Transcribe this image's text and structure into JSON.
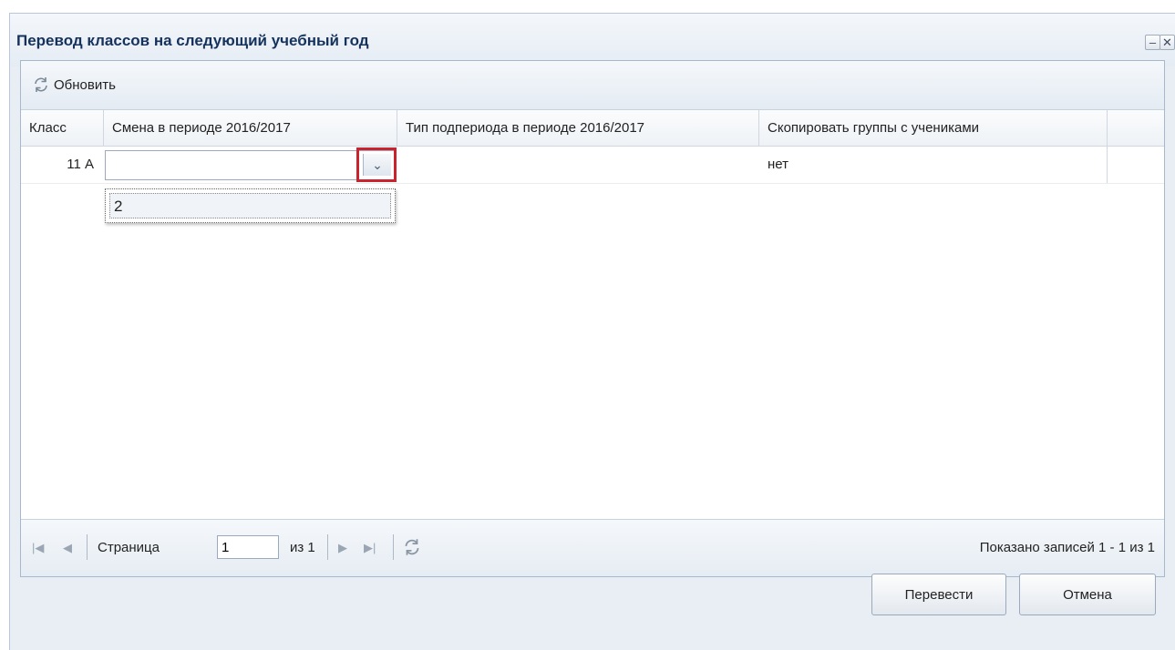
{
  "window": {
    "title": "Перевод классов на следующий учебный год"
  },
  "toolbar": {
    "refresh_label": "Обновить"
  },
  "grid": {
    "columns": [
      "Класс",
      "Смена в периоде 2016/2017",
      "Тип подпериода в периоде 2016/2017",
      "Скопировать группы с учениками"
    ],
    "rows": [
      {
        "class": "11 А",
        "shift": "",
        "subperiod_type": "",
        "copy_groups": "нет"
      }
    ],
    "dropdown_options": [
      "2"
    ]
  },
  "pager": {
    "page_label": "Страница",
    "page_value": "1",
    "of_label": "из 1",
    "summary": "Показано записей 1 - 1 из 1"
  },
  "buttons": {
    "confirm": "Перевести",
    "cancel": "Отмена"
  },
  "icons": {
    "minimize": "minimize-icon",
    "close": "close-icon",
    "refresh": "refresh-icon",
    "first": "first-page-icon",
    "prev": "prev-page-icon",
    "next": "next-page-icon",
    "last": "last-page-icon"
  },
  "colors": {
    "title": "#15325c",
    "highlight": "#c9232d"
  }
}
